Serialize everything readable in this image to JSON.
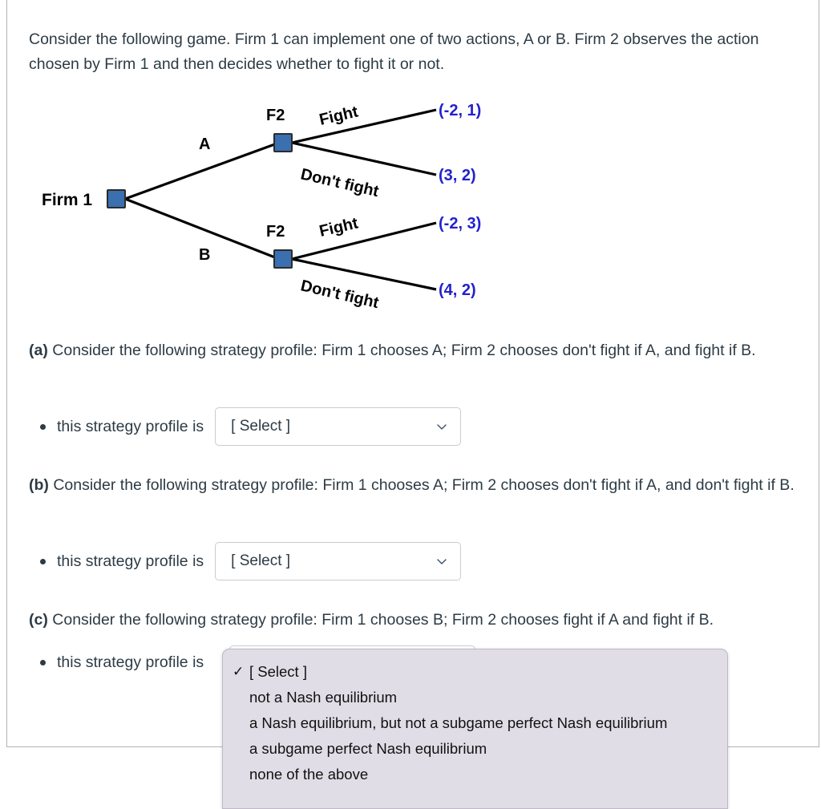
{
  "intro": {
    "paragraph": "Consider the following game. Firm 1 can implement one of two actions, A or B. Firm 2 observes the action chosen by Firm 1 and then decides whether to fight it or not."
  },
  "figure": {
    "caption": "extensive form game tree",
    "root_label": "Firm 1",
    "node_color": "#3a6fb0",
    "node_border_color": "#1f3a5f",
    "payoff_color": "#2222cc",
    "firm1_actions": [
      "A",
      "B"
    ],
    "firm2_label": "F2",
    "firm2_actions": [
      "Fight",
      "Don't fight"
    ],
    "nodes": [
      {
        "id": "root",
        "label": "Firm 1",
        "player": "Firm 1"
      },
      {
        "id": "f2-top",
        "label": "F2",
        "player": "Firm 2"
      },
      {
        "id": "f2-bottom",
        "label": "F2",
        "player": "Firm 2"
      }
    ],
    "branches": [
      {
        "from": "root",
        "to": "f2-top",
        "label": "A"
      },
      {
        "from": "root",
        "to": "f2-bottom",
        "label": "B"
      },
      {
        "from": "f2-top",
        "to": "payoff-1",
        "label": "Fight"
      },
      {
        "from": "f2-top",
        "to": "payoff-2",
        "label": "Don't fight"
      },
      {
        "from": "f2-bottom",
        "to": "payoff-3",
        "label": "Fight"
      },
      {
        "from": "f2-bottom",
        "to": "payoff-4",
        "label": "Don't fight"
      }
    ],
    "payoffs": [
      {
        "id": "payoff-1",
        "path": "A, Fight",
        "text": "(-2, 1)",
        "firm1": -2,
        "firm2": 1
      },
      {
        "id": "payoff-2",
        "path": "A, Don't fight",
        "text": "(3, 2)",
        "firm1": 3,
        "firm2": 2
      },
      {
        "id": "payoff-3",
        "path": "B, Fight",
        "text": "(-2, 3)",
        "firm1": -2,
        "firm2": 3
      },
      {
        "id": "payoff-4",
        "path": "B, Don't fight",
        "text": "(4, 2)",
        "firm1": 4,
        "firm2": 2
      }
    ]
  },
  "questions": [
    {
      "key": "a",
      "marker": "(a)",
      "prompt": "Consider the following strategy profile: Firm 1 chooses A; Firm 2 chooses don't fight if A, and fight if B.",
      "answer_label": "this strategy profile is",
      "select_value": "[ Select ]"
    },
    {
      "key": "b",
      "marker": "(b)",
      "prompt": "Consider the following strategy profile: Firm 1 chooses A; Firm 2 chooses don't fight if A, and don't fight if B.",
      "answer_label": "this strategy profile is",
      "select_value": "[ Select ]"
    },
    {
      "key": "c",
      "marker": "(c)",
      "prompt": "Consider the following strategy profile: Firm 1 chooses B; Firm 2 chooses fight if A and fight if B.",
      "answer_label": "this strategy profile is",
      "select_value": "[ Select ]"
    }
  ],
  "dropdown": {
    "open_for_question": "c",
    "checkmark": "✓",
    "options": [
      {
        "label": "[ Select ]",
        "selected": true
      },
      {
        "label": "not a Nash equilibrium",
        "selected": false
      },
      {
        "label": "a Nash equilibrium, but not a subgame perfect Nash equilibrium",
        "selected": false
      },
      {
        "label": "a subgame perfect Nash equilibrium",
        "selected": false
      },
      {
        "label": "none of the above",
        "selected": false
      }
    ]
  },
  "icons": {
    "chevron_down": "chevron-down-icon"
  }
}
